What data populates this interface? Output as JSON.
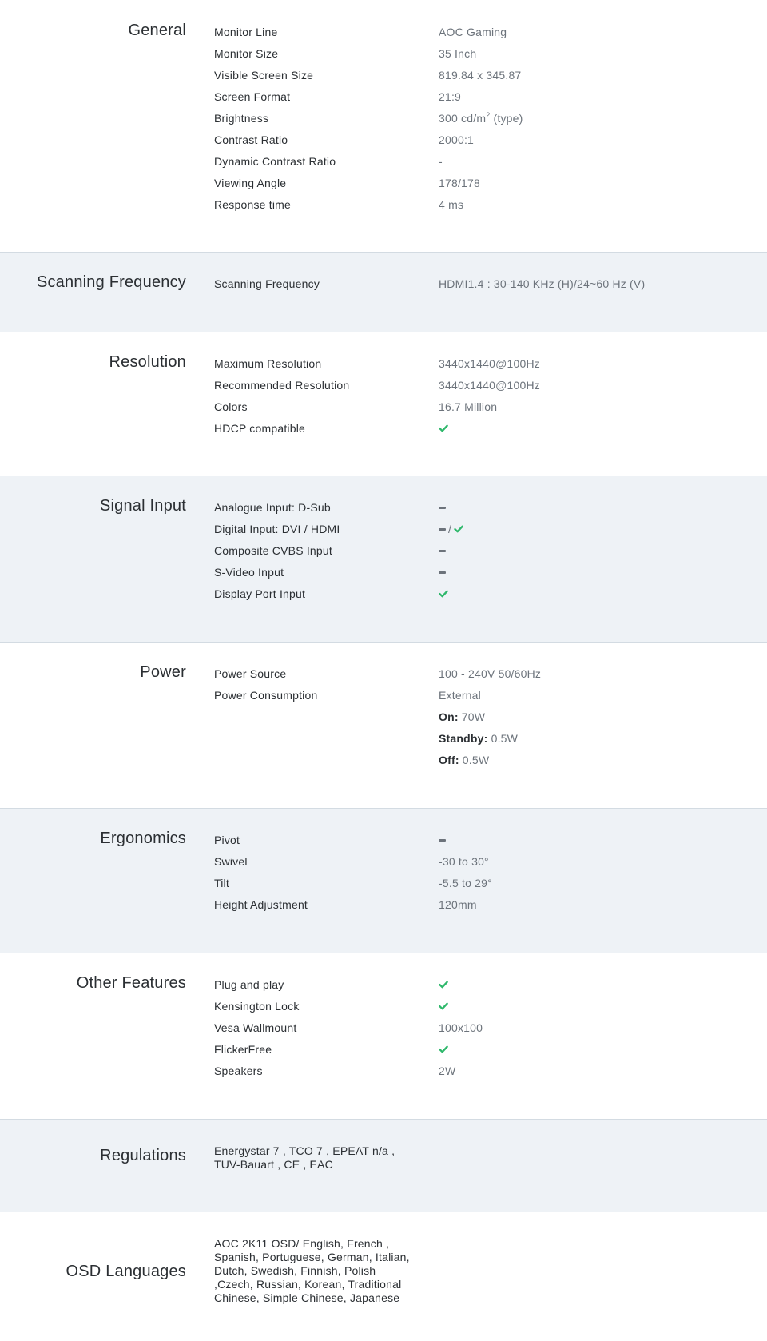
{
  "sections": {
    "general": {
      "title": "General",
      "rows": [
        {
          "label": "Monitor Line",
          "value": "AOC Gaming"
        },
        {
          "label": "Monitor Size",
          "value": "35 Inch"
        },
        {
          "label": "Visible Screen Size",
          "value": "819.84 x 345.87"
        },
        {
          "label": "Screen Format",
          "value": "21:9"
        },
        {
          "label": "Brightness",
          "value": "300 cd/m",
          "value_sup": "2",
          "value_suffix": " (type)"
        },
        {
          "label": "Contrast Ratio",
          "value": "2000:1"
        },
        {
          "label": "Dynamic Contrast Ratio",
          "value": "-"
        },
        {
          "label": "Viewing Angle",
          "value": "178/178"
        },
        {
          "label": "Response time",
          "value": "4 ms"
        }
      ]
    },
    "scanning": {
      "title": "Scanning Frequency",
      "rows": [
        {
          "label": "Scanning Frequency",
          "value": "HDMI1.4 : 30-140 KHz (H)/24~60 Hz (V)"
        }
      ]
    },
    "resolution": {
      "title": "Resolution",
      "rows": [
        {
          "label": "Maximum Resolution",
          "value": "3440x1440@100Hz"
        },
        {
          "label": "Recommended Resolution",
          "value": "3440x1440@100Hz"
        },
        {
          "label": "Colors",
          "value": "16.7 Million"
        },
        {
          "label": "HDCP compatible",
          "icon": "check-icon"
        }
      ]
    },
    "signal": {
      "title": "Signal Input",
      "rows": [
        {
          "label": "Analogue Input: D-Sub",
          "icon": "dash-icon"
        },
        {
          "label": "Digital Input: DVI / HDMI",
          "icon": "dash-icon",
          "separator": "/",
          "icon2": "check-icon"
        },
        {
          "label": "Composite CVBS Input",
          "icon": "dash-icon"
        },
        {
          "label": "S-Video Input",
          "icon": "dash-icon"
        },
        {
          "label": "Display Port Input",
          "icon": "check-icon"
        }
      ]
    },
    "power": {
      "title": "Power",
      "rows": [
        {
          "label": "Power Source",
          "value": "100 - 240V 50/60Hz"
        },
        {
          "label": "Power Consumption",
          "value": "External"
        },
        {
          "label": "",
          "bold": "On:",
          "value": " 70W"
        },
        {
          "label": "",
          "bold": "Standby:",
          "value": " 0.5W"
        },
        {
          "label": "",
          "bold": "Off:",
          "value": " 0.5W"
        }
      ]
    },
    "ergonomics": {
      "title": "Ergonomics",
      "rows": [
        {
          "label": "Pivot",
          "icon": "dash-icon"
        },
        {
          "label": "Swivel",
          "value": "-30 to 30°"
        },
        {
          "label": "Tilt",
          "value": "-5.5 to 29°"
        },
        {
          "label": "Height Adjustment",
          "value": "120mm"
        }
      ]
    },
    "other": {
      "title": "Other Features",
      "rows": [
        {
          "label": "Plug and play",
          "icon": "check-icon"
        },
        {
          "label": "Kensington Lock",
          "icon": "check-icon"
        },
        {
          "label": "Vesa Wallmount",
          "value": "100x100"
        },
        {
          "label": "FlickerFree",
          "icon": "check-icon"
        },
        {
          "label": "Speakers",
          "value": "2W"
        }
      ]
    },
    "regulations": {
      "title": "Regulations",
      "text": "Energystar 7 , TCO 7 , EPEAT n/a , TUV-Bauart , CE , EAC"
    },
    "osd": {
      "title": "OSD Languages",
      "text": "AOC 2K11 OSD/ English, French , Spanish, Portuguese, German, Italian, Dutch, Swedish, Finnish, Polish ,Czech, Russian, Korean, Traditional Chinese, Simple Chinese, Japanese"
    }
  },
  "colors": {
    "shaded_background": "#eef2f6",
    "divider": "#d3dbe2",
    "check_green": "#2eb86b",
    "dash_gray": "#6c737b"
  }
}
